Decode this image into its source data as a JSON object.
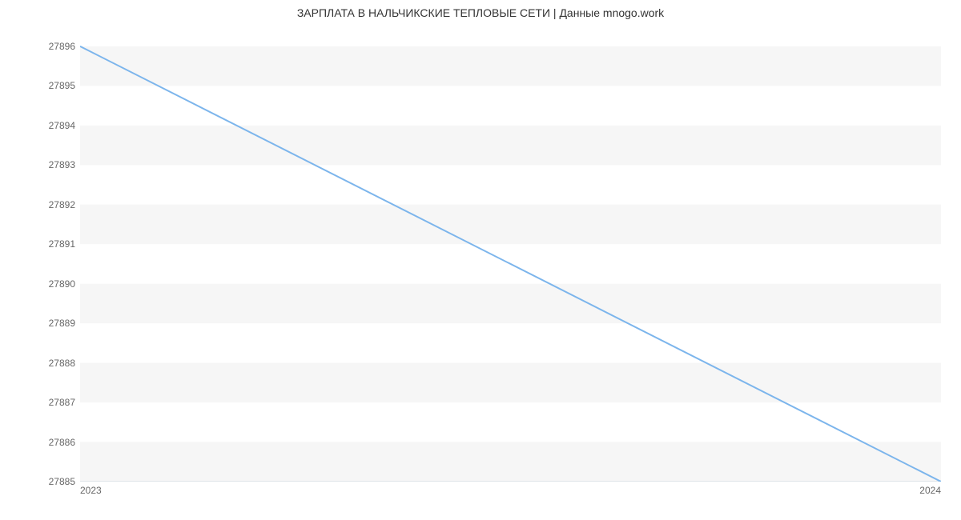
{
  "chart_data": {
    "type": "line",
    "title": "ЗАРПЛАТА В  НАЛЬЧИКСКИЕ ТЕПЛОВЫЕ СЕТИ | Данные mnogo.work",
    "x": [
      2023,
      2024
    ],
    "values": [
      27896,
      27885
    ],
    "x_ticks": [
      "2023",
      "2024"
    ],
    "y_ticks": [
      27885,
      27886,
      27887,
      27888,
      27889,
      27890,
      27891,
      27892,
      27893,
      27894,
      27895,
      27896
    ],
    "xlim": [
      2023,
      2024
    ],
    "ylim": [
      27885,
      27896.2
    ],
    "line_color": "#7cb5ec",
    "band_color": "#f6f6f6",
    "axis_color": "#c8d1db"
  }
}
